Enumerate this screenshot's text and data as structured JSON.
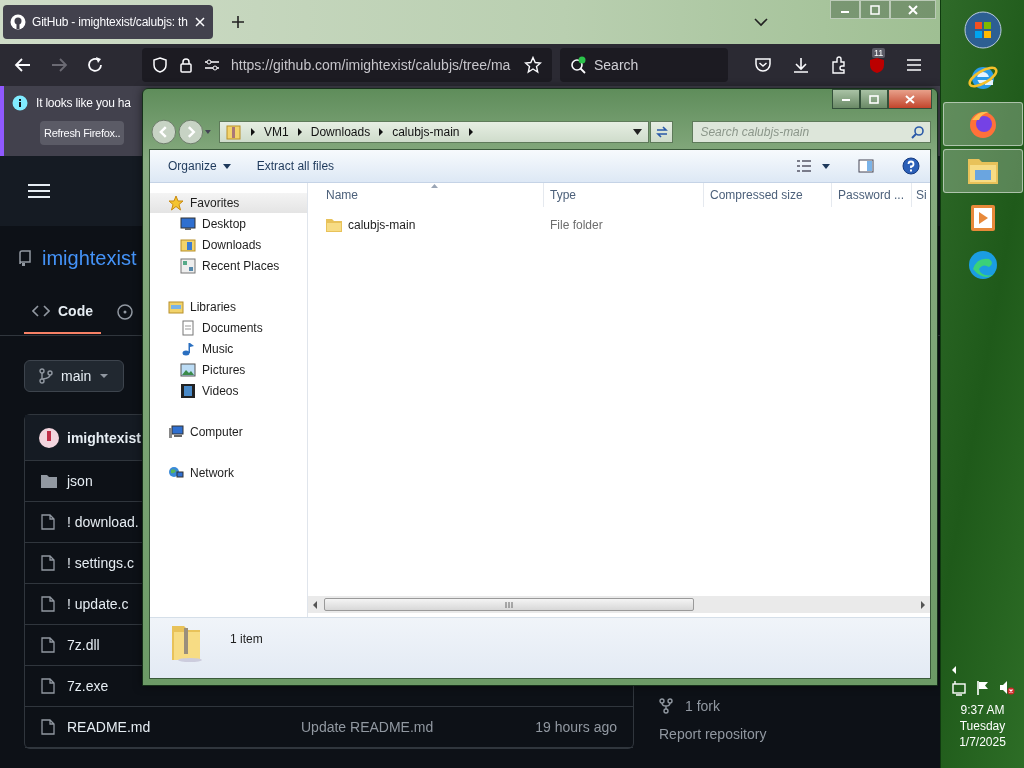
{
  "browser": {
    "tabs": [
      {
        "title": "GitHub - imightexist/calubjs: th",
        "selected": true
      }
    ],
    "nav_buttons": [
      {
        "kind": "back",
        "disabled": false
      },
      {
        "kind": "forward",
        "disabled": true
      },
      {
        "kind": "reload",
        "disabled": false
      }
    ],
    "url": "https://github.com/imightexist/calubjs/tree/ma",
    "search_placeholder": "Search",
    "extension_badge": "11"
  },
  "infobar": {
    "message": "It looks like you ha",
    "button": "Refresh Firefox.."
  },
  "github": {
    "repo_owner": "imightexist",
    "tabs": [
      {
        "label": "Code",
        "selected": true
      }
    ],
    "branch": "main",
    "commit_author": "imightexist",
    "files": [
      {
        "kind": "folder",
        "name": "json"
      },
      {
        "kind": "file",
        "name": "! download."
      },
      {
        "kind": "file",
        "name": "! settings.c"
      },
      {
        "kind": "file",
        "name": "! update.c"
      },
      {
        "kind": "file",
        "name": "7z.dll"
      },
      {
        "kind": "file",
        "name": "7z.exe"
      },
      {
        "kind": "file",
        "name": "README.md",
        "message": "Update README.md",
        "time": "19 hours ago"
      }
    ],
    "forks": "1 fork",
    "report": "Report repository"
  },
  "explorer": {
    "breadcrumb": [
      "VM1",
      "Downloads",
      "calubjs-main"
    ],
    "search_placeholder": "Search calubjs-main",
    "commands": [
      {
        "label": "Organize",
        "menu": true
      },
      {
        "label": "Extract all files",
        "menu": false
      }
    ],
    "nav": [
      {
        "label": "Favorites",
        "kind": "favorites",
        "selected": true,
        "children": [
          {
            "label": "Desktop",
            "kind": "desktop"
          },
          {
            "label": "Downloads",
            "kind": "downloads"
          },
          {
            "label": "Recent Places",
            "kind": "recent"
          }
        ]
      },
      {
        "label": "Libraries",
        "kind": "libraries",
        "selected": false,
        "children": [
          {
            "label": "Documents",
            "kind": "documents"
          },
          {
            "label": "Music",
            "kind": "music"
          },
          {
            "label": "Pictures",
            "kind": "pictures"
          },
          {
            "label": "Videos",
            "kind": "videos"
          }
        ]
      },
      {
        "label": "Computer",
        "kind": "computer",
        "selected": false
      },
      {
        "label": "Network",
        "kind": "network",
        "selected": false
      }
    ],
    "columns": [
      "Name",
      "Type",
      "Compressed size",
      "Password ...",
      "Si"
    ],
    "items": [
      {
        "name": "calubjs-main",
        "type": "File folder"
      }
    ],
    "status": "1 item"
  },
  "taskbar": {
    "apps": [
      {
        "kind": "start",
        "selected": false
      },
      {
        "kind": "ie",
        "selected": false
      },
      {
        "kind": "firefox",
        "selected": true
      },
      {
        "kind": "explorer",
        "selected": true
      },
      {
        "kind": "media",
        "selected": false
      },
      {
        "kind": "edge",
        "selected": false
      }
    ],
    "clock": {
      "time": "9:37 AM",
      "day": "Tuesday",
      "date": "1/7/2025"
    }
  }
}
